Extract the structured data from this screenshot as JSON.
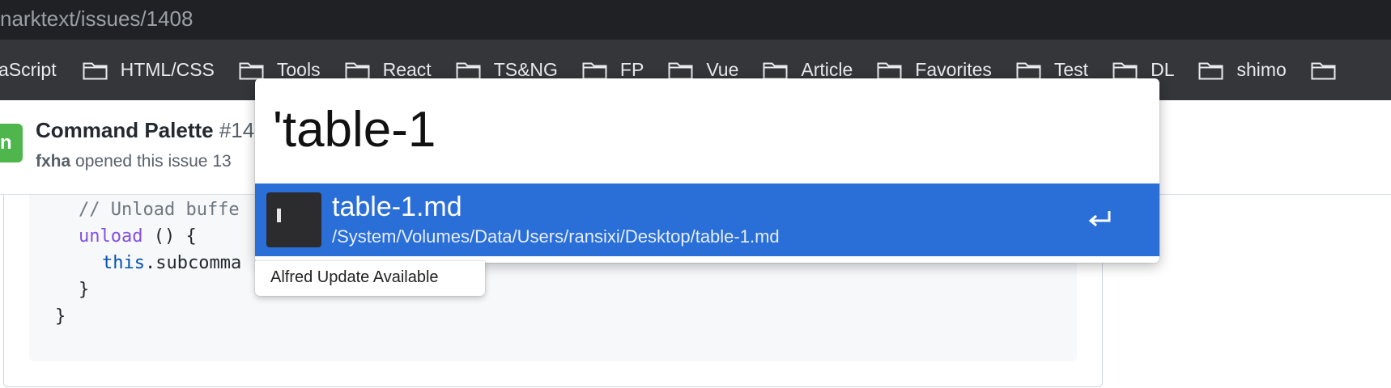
{
  "browser": {
    "url_text": "narktext/issues/1408"
  },
  "bookmarks": {
    "first_partial": "aScript",
    "folders": [
      "HTML/CSS",
      "Tools",
      "React",
      "TS&NG",
      "FP",
      "Vue",
      "Article",
      "Favorites",
      "Test",
      "DL",
      "shimo",
      ""
    ]
  },
  "issue": {
    "avatar_letter": "n",
    "title": "Command Palette",
    "number": "#14",
    "author": "fxha",
    "meta_text": "opened this issue 13"
  },
  "code": {
    "lines": [
      {
        "comment": "// Unload buffe"
      },
      {
        "keyword": "unload",
        "rest": " () {"
      },
      {
        "this_kw": "this",
        "rest": ".subcomma"
      },
      {
        "text": "}"
      },
      {
        "text": "}"
      }
    ]
  },
  "alfred": {
    "query": "'table-1",
    "result": {
      "title": "table-1.md",
      "path": "/System/Volumes/Data/Users/ransixi/Desktop/table-1.md",
      "icon": "text-document-icon",
      "action_icon": "enter-return-icon"
    },
    "update_notice": "Alfred Update Available"
  },
  "colors": {
    "selection": "#2a6ed8",
    "bookmarks_bar": "#35363a",
    "url_bar": "#202124",
    "avatar_green": "#4fb64d"
  }
}
